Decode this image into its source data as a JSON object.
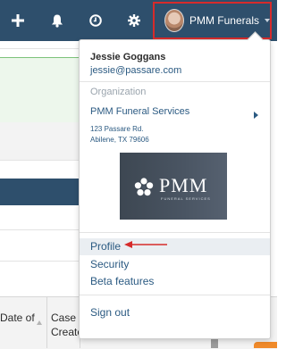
{
  "topbar": {
    "icons": [
      "plus-icon",
      "bell-icon",
      "clock-icon",
      "gear-icon"
    ],
    "account_name": "PMM Funerals",
    "highlight_color": "#d62b2b",
    "bar_color": "#2e4f6c"
  },
  "background": {
    "columns": [
      {
        "label_line1": "Date of",
        "label_line2": ""
      },
      {
        "label_line1": "Case",
        "label_line2": "Create"
      }
    ]
  },
  "dropdown": {
    "user_name": "Jessie Goggans",
    "user_email": "jessie@passare.com",
    "section_label": "Organization",
    "org_name": "PMM Funeral Services",
    "address_line1": "123 Passare Rd.",
    "address_line2": "Abilene, TX 79606",
    "logo_text": "PMM",
    "logo_subtext": "FUNERAL SERVICES",
    "menu": [
      "Profile",
      "Security",
      "Beta features"
    ],
    "sign_out": "Sign out"
  }
}
